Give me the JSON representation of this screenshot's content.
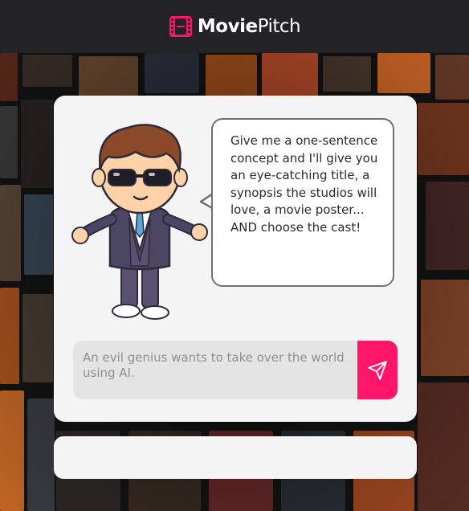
{
  "header": {
    "logo_icon": "film-strip-icon",
    "brand_bold": "Movie",
    "brand_light": "Pitch",
    "accent_color": "#ff1669"
  },
  "card": {
    "mascot": "cartoon-director-mascot",
    "speech_text": "Give me a one-sentence concept and I'll give you an eye-catching title, a synopsis the studios will love, a movie poster... AND choose the cast!",
    "input_placeholder": "An evil genius wants to take over the world using AI.",
    "input_value": "",
    "send_icon": "paper-plane-icon"
  },
  "output": {
    "text": ""
  }
}
